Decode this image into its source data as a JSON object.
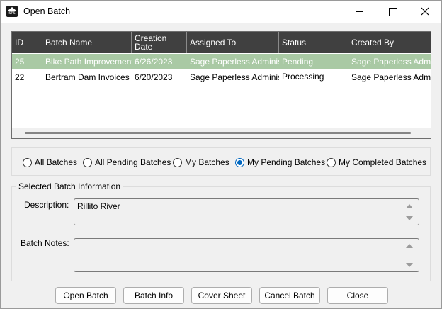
{
  "window": {
    "title": "Open Batch",
    "icon_text": "SPS",
    "controls": [
      "minimize-icon",
      "maximize-icon",
      "close-icon"
    ]
  },
  "grid": {
    "columns": [
      "ID",
      "Batch Name",
      "Creation Date",
      "Assigned To",
      "Status",
      "Created By"
    ],
    "column_lines": [
      [
        "ID"
      ],
      [
        "Batch Name"
      ],
      [
        "Creation",
        "Date"
      ],
      [
        "Assigned To"
      ],
      [
        "Status"
      ],
      [
        "Created By"
      ]
    ],
    "rows": [
      {
        "id": "25",
        "name": "Bike Path Improvements",
        "date": "6/26/2023",
        "assigned": "Sage Paperless Adminis...",
        "status": "Pending",
        "created_by": "Sage Paperless Admi...",
        "selected": true
      },
      {
        "id": "22",
        "name": "Bertram Dam Invoices",
        "date": "6/20/2023",
        "assigned": "Sage Paperless Adminis...",
        "status": "Processing",
        "created_by": "Sage Paperless Admi...",
        "selected": false
      }
    ],
    "selected_row_color": "#a9c9a4",
    "header_color": "#404040"
  },
  "filters": {
    "options": [
      "All Batches",
      "All Pending Batches",
      "My Batches",
      "My Pending Batches",
      "My Completed Batches"
    ],
    "selected": "My Pending Batches",
    "accent": "#0067c0"
  },
  "info": {
    "legend": "Selected Batch Information",
    "description_label": "Description:",
    "description_value": "Rillito River",
    "notes_label": "Batch Notes:",
    "notes_value": ""
  },
  "buttons": {
    "open": "Open Batch",
    "info": "Batch Info",
    "cover": "Cover Sheet",
    "cancel": "Cancel Batch",
    "close": "Close"
  }
}
